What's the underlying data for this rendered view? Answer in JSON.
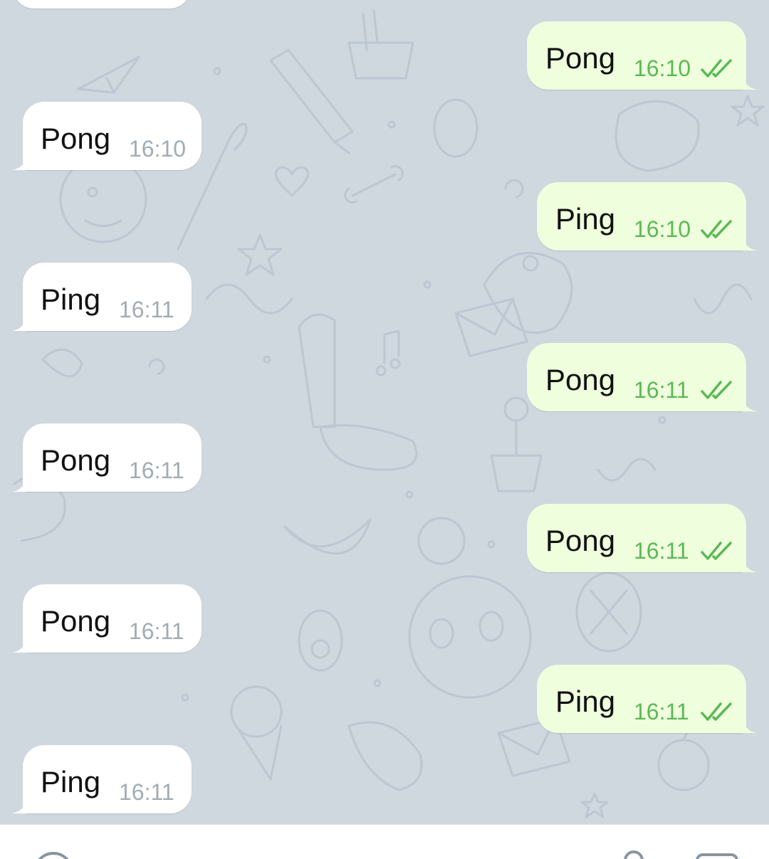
{
  "colors": {
    "chat_background": "#cfd7df",
    "incoming_bubble": "#ffffff",
    "outgoing_bubble": "#effedd",
    "incoming_time": "#a2acb4",
    "outgoing_time": "#5bb957",
    "read_check": "#5bb957"
  },
  "messages": [
    {
      "direction": "outgoing",
      "text": "Pong",
      "time": "16:10",
      "status_icon": "double-check-icon"
    },
    {
      "direction": "incoming",
      "text": "Pong",
      "time": "16:10"
    },
    {
      "direction": "outgoing",
      "text": "Ping",
      "time": "16:10",
      "status_icon": "double-check-icon"
    },
    {
      "direction": "incoming",
      "text": "Ping",
      "time": "16:11"
    },
    {
      "direction": "outgoing",
      "text": "Pong",
      "time": "16:11",
      "status_icon": "double-check-icon"
    },
    {
      "direction": "incoming",
      "text": "Pong",
      "time": "16:11"
    },
    {
      "direction": "outgoing",
      "text": "Pong",
      "time": "16:11",
      "status_icon": "double-check-icon"
    },
    {
      "direction": "incoming",
      "text": "Pong",
      "time": "16:11"
    },
    {
      "direction": "outgoing",
      "text": "Ping",
      "time": "16:11",
      "status_icon": "double-check-icon"
    },
    {
      "direction": "incoming",
      "text": "Ping",
      "time": "16:11"
    }
  ],
  "input_bar": {
    "left_icon": "emoji-icon",
    "right_icons": [
      "attach-icon",
      "camera-icon"
    ]
  }
}
